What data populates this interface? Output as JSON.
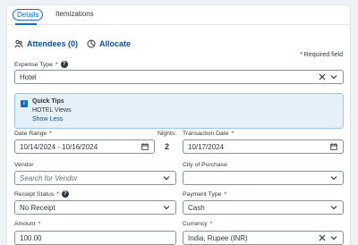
{
  "tabs": [
    {
      "label": "Details",
      "active": true
    },
    {
      "label": "Itemizations",
      "active": false
    }
  ],
  "actions": {
    "attendees": "Attendees (0)",
    "allocate": "Allocate"
  },
  "required_note": "Required field",
  "expense_type": {
    "label": "Expense Type",
    "value": "Hotel"
  },
  "quick_tips": {
    "title": "Quick Tips",
    "body": "HOTEL Views",
    "toggle": "Show Less"
  },
  "date_range": {
    "label": "Date Range",
    "value": "10/14/2024 - 10/16/2024"
  },
  "nights": {
    "label": "Nights:",
    "value": "2"
  },
  "transaction_date": {
    "label": "Transaction Date",
    "value": "10/17/2024"
  },
  "vendor": {
    "label": "Vendor",
    "placeholder": "Search for Vendor"
  },
  "city_of_purchase": {
    "label": "City of Purchase",
    "value": ""
  },
  "receipt_status": {
    "label": "Receipt Status",
    "value": "No Receipt"
  },
  "payment_type": {
    "label": "Payment Type",
    "value": "Cash"
  },
  "amount": {
    "label": "Amount",
    "value": "100.00"
  },
  "currency": {
    "label": "Currency",
    "value": "India, Rupee (INR)"
  },
  "colors": {
    "accent": "#0a6ed1",
    "link": "#0a4e9b",
    "required": "#bb0000",
    "tips_bg": "#e5f0fa"
  }
}
